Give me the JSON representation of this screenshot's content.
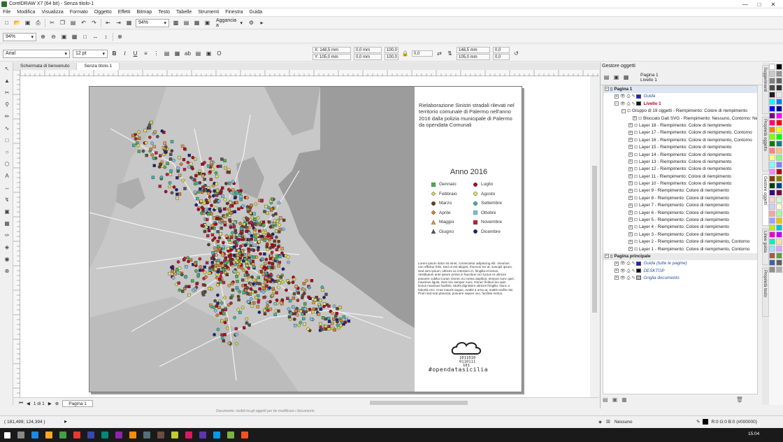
{
  "window": {
    "title": "CorelDRAW X7 (64 bit) - Senza titolo-1"
  },
  "menu": [
    "File",
    "Modifica",
    "Visualizza",
    "Formato",
    "Oggetto",
    "Effetti",
    "Bitmap",
    "Testo",
    "Tabelle",
    "Strumenti",
    "Finestra",
    "Guida"
  ],
  "toolbar": {
    "zoom_value": "94%",
    "snap_label": "Aggancia a",
    "zoom2_value": "94%"
  },
  "propbar": {
    "font_value": "Arial",
    "size_value": "12 pt",
    "x_value": "X: 148,5 mm",
    "y_value": "Y: 105,0 mm",
    "w_value": "0,0 mm",
    "h_value": "0,0 mm",
    "scale_x": "100,0",
    "scale_y": "100,0",
    "angle": "0,0",
    "x2_value": "148,5 mm",
    "y2_value": "105,0 mm",
    "pct_x": "0,0",
    "pct_y": "0,0"
  },
  "doc_tabs": [
    "Schermata di benvenuto",
    "Senza titolo-1"
  ],
  "document": {
    "heading": "Rielaborazione Sinistri stradali rilevati nel territorio comunale di Palermo nell'anno 2016 dalla polizia municipale di Palermo da opendata Comunali",
    "year_title": "Anno 2016",
    "legend": [
      {
        "label": "Gennaio",
        "color": "#4caf50",
        "shape": "square"
      },
      {
        "label": "Luglio",
        "color": "#b3001b",
        "shape": "circle"
      },
      {
        "label": "Febbraio",
        "color": "#d6d64a",
        "shape": "diamond"
      },
      {
        "label": "Agosto",
        "color": "#e0e070",
        "shape": "circle"
      },
      {
        "label": "Marzo",
        "color": "#6b3b1e",
        "shape": "circle"
      },
      {
        "label": "Settembre",
        "color": "#40b4a6",
        "shape": "circle"
      },
      {
        "label": "Aprile",
        "color": "#d08030",
        "shape": "diamond"
      },
      {
        "label": "Ottobre",
        "color": "#80c0e0",
        "shape": "square"
      },
      {
        "label": "Maggio",
        "color": "#e0a040",
        "shape": "triangle"
      },
      {
        "label": "Novembre",
        "color": "#c0203a",
        "shape": "square"
      },
      {
        "label": "Giugno",
        "color": "#555555",
        "shape": "triangle"
      },
      {
        "label": "Dicembre",
        "color": "#1a237e",
        "shape": "circle"
      }
    ],
    "lorem": "Lorem ipsum dolor sit amet, consectetur adipiscing elit. Vivamus non efficitur felis. Sed ut est aliquet, rhoncus leo at, suscipit ipsum. Sed sem ipsum, ultrices ac interdum in, fringilla et lectus. Vestibulum ante ipsum primis in faucibus orci luctus et ultrices posuere cubilia Curae; Donec eu metus dapibus, tempus nunc quis, maximus ligula. Sed non semper nunc. Donec finibus leo quis lectus maximus facilisis. Morbi dignissim ultrices fringilla. Nunc a lobortis orci. Cras mauris augue, mattis a urna at, mattis mollis nisi. Proin sed erat placerat, posuere sapien nec, facilisis metus.",
    "logo_bits": [
      "1011010",
      "0110111",
      "101"
    ],
    "hashtag": "#opendatasicilia"
  },
  "page_nav": {
    "counter": "1 di 1",
    "page_tab": "Pagina 1"
  },
  "canvas_hint": "Documento: visibili tra gli oggetti per far modificare i documento",
  "docker": {
    "title": "Gestore oggetti",
    "header_page": "Pagina 1",
    "header_layer": "Livello 1",
    "rows": [
      {
        "text": "Pagina 1",
        "type": "hdr",
        "indent": 0
      },
      {
        "text": "Guida",
        "type": "guide",
        "indent": 14,
        "swatch": "#1a22d0"
      },
      {
        "text": "Livello 1",
        "type": "layer",
        "indent": 14,
        "swatch": "#111111"
      },
      {
        "text": "Gruppo di 19 oggetti - Riempimento: Colore di riempimento",
        "type": "item",
        "indent": 24
      },
      {
        "text": "Bloccato Dati SVG - Riempimento: Nessuno, Contorno: Nessuno",
        "type": "item",
        "indent": 40
      },
      {
        "text": "Layer 18 - Riempimento: Colore di riempimento",
        "type": "item",
        "indent": 34
      },
      {
        "text": "Layer 17 - Riempimento: Colore di riempimento, Contorno",
        "type": "item",
        "indent": 34
      },
      {
        "text": "Layer 16 - Riempimento: Colore di riempimento, Contorno",
        "type": "item",
        "indent": 34
      },
      {
        "text": "Layer 15 - Riempimento: Colore di riempimento",
        "type": "item",
        "indent": 34
      },
      {
        "text": "Layer 14 - Riempimento: Colore di riempimento",
        "type": "item",
        "indent": 34
      },
      {
        "text": "Layer 13 - Riempimento: Colore di riempimento",
        "type": "item",
        "indent": 34
      },
      {
        "text": "Layer 12 - Riempimento: Colore di riempimento",
        "type": "item",
        "indent": 34
      },
      {
        "text": "Layer 11 - Riempimento: Colore di riempimento",
        "type": "item",
        "indent": 34
      },
      {
        "text": "Layer 10 - Riempimento: Colore di riempimento",
        "type": "item",
        "indent": 34
      },
      {
        "text": "Layer 9 - Riempimento: Colore di riempimento",
        "type": "item",
        "indent": 34
      },
      {
        "text": "Layer 8 - Riempimento: Colore di riempimento",
        "type": "item",
        "indent": 34
      },
      {
        "text": "Layer 7 - Riempimento: Colore di riempimento",
        "type": "item",
        "indent": 34
      },
      {
        "text": "Layer 6 - Riempimento: Colore di riempimento",
        "type": "item",
        "indent": 34
      },
      {
        "text": "Layer 5 - Riempimento: Colore di riempimento",
        "type": "item",
        "indent": 34
      },
      {
        "text": "Layer 4 - Riempimento: Colore di riempimento",
        "type": "item",
        "indent": 34
      },
      {
        "text": "Layer 3 - Riempimento: Colore di riempimento",
        "type": "item",
        "indent": 34
      },
      {
        "text": "Layer 2 - Riempimento: Colore di riempimento, Contorno",
        "type": "item",
        "indent": 34
      },
      {
        "text": "Layer 1 - Riempimento: Colore di riempimento, Contorno",
        "type": "item",
        "indent": 34
      },
      {
        "text": "Pagina principale",
        "type": "hdr2",
        "indent": 0
      },
      {
        "text": "Guida (tutte le pagine)",
        "type": "guide",
        "indent": 14,
        "swatch": "#1a22d0"
      },
      {
        "text": "DESKTOP",
        "type": "guide",
        "indent": 14,
        "swatch": "#111111"
      },
      {
        "text": "Griglia documento",
        "type": "guide",
        "indent": 14,
        "swatch": "#bbbbbb"
      }
    ]
  },
  "side_tabs": [
    "Suggerimenti",
    "Proprietà oggetto",
    "Gestore oggetti",
    "Linee guida",
    "Proprietà testo"
  ],
  "palette_colors": [
    "#ffffff",
    "#000000",
    "#c8c8c8",
    "#969696",
    "#808080",
    "#646464",
    "#4b4b4b",
    "#323232",
    "#1e1e1e",
    "#e8e8e8",
    "#00ffff",
    "#0080ff",
    "#0000ff",
    "#000080",
    "#800080",
    "#ff00ff",
    "#ff0080",
    "#ff0000",
    "#ff8000",
    "#ffff00",
    "#80ff00",
    "#00ff00",
    "#008000",
    "#008080",
    "#ff8080",
    "#ffc080",
    "#ffff80",
    "#80ff80",
    "#80ffff",
    "#8080ff",
    "#ff80ff",
    "#c00000",
    "#804000",
    "#808000",
    "#004000",
    "#004080",
    "#400080",
    "#800040",
    "#ffd0d0",
    "#d0ffd0",
    "#d0d0ff",
    "#ffffd0",
    "#ffa0a0",
    "#a0ffa0",
    "#a0a0ff",
    "#f0c000",
    "#c0f000",
    "#00c0f0",
    "#f000c0",
    "#c000f0",
    "#00f0c0",
    "#ffe0a0",
    "#a0e0ff",
    "#e0a0ff",
    "#a06040",
    "#60a040",
    "#4060a0",
    "#606060",
    "#909090",
    "#b0b0b0"
  ],
  "status": {
    "coords": "( 181,499; 124,394 )",
    "fill_label": "Nessuno",
    "outline_label": "R:0 G:0 B:0 (#000000)"
  },
  "taskbar": {
    "clock": "15:04"
  }
}
